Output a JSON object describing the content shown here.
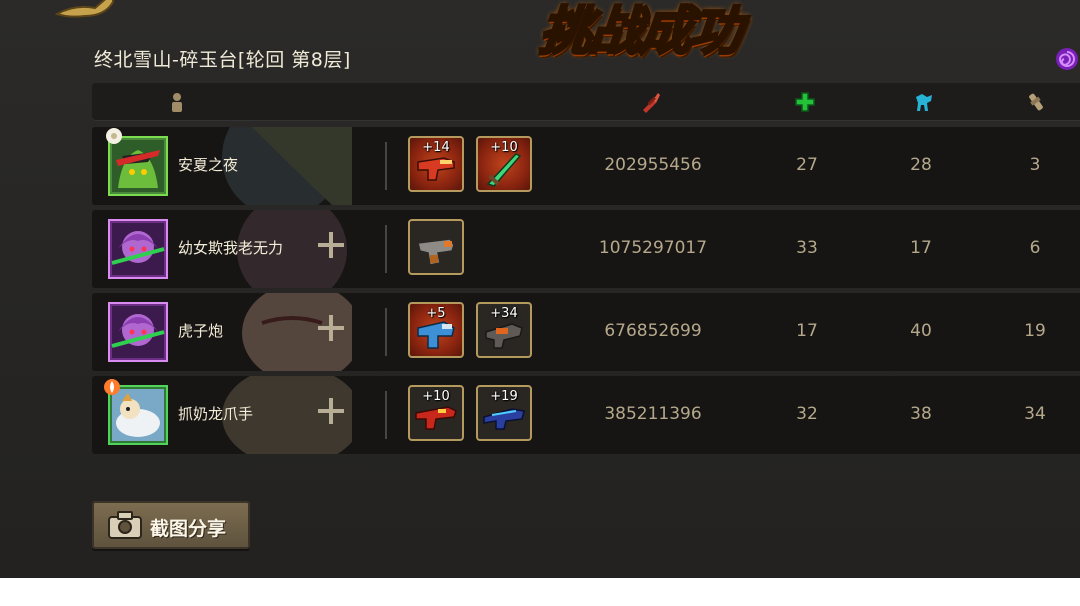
{
  "banner": {
    "title": "挑战成功"
  },
  "stage": {
    "name": "终北雪山-碎玉台[轮回  第8层]"
  },
  "header": {
    "icons": [
      "player-icon",
      "damage-icon",
      "heal-icon",
      "damage-taken-icon",
      "rescue-icon"
    ]
  },
  "colors": {
    "title": "#ffb21e",
    "text": "#f3ecd6",
    "stat": "#b5a88b",
    "item_border": "#b59a5e",
    "heal": "#24c23a",
    "damage": "#c0362a",
    "taken": "#27b3d6"
  },
  "players": [
    {
      "name": "安夏之夜",
      "frame_color": "#3fae3f",
      "has_add": false,
      "items": [
        {
          "level": "+14",
          "icon": "red-blaster-icon",
          "rare": true
        },
        {
          "level": "+10",
          "icon": "green-sword-icon",
          "rare": true
        }
      ],
      "damage": "202955456",
      "heal": "27",
      "taken": "28",
      "save": "3"
    },
    {
      "name": "幼女欺我老无力",
      "frame_color": "#b35bc8",
      "has_add": true,
      "items": [
        {
          "level": "",
          "icon": "pistol-icon",
          "rare": false
        }
      ],
      "damage": "1075297017",
      "heal": "33",
      "taken": "17",
      "save": "6"
    },
    {
      "name": "虎子炮",
      "frame_color": "#b35bc8",
      "has_add": true,
      "items": [
        {
          "level": "+5",
          "icon": "blue-blaster-icon",
          "rare": true
        },
        {
          "level": "+34",
          "icon": "orange-gun-icon",
          "rare": false
        }
      ],
      "damage": "676852699",
      "heal": "17",
      "taken": "40",
      "save": "19"
    },
    {
      "name": "抓奶龙爪手",
      "frame_color": "#3fae3f",
      "has_add": true,
      "items": [
        {
          "level": "+10",
          "icon": "red-rifle-icon",
          "rare": false
        },
        {
          "level": "+19",
          "icon": "blue-rifle-icon",
          "rare": false
        }
      ],
      "damage": "385211396",
      "heal": "32",
      "taken": "38",
      "save": "34"
    }
  ],
  "share_button": {
    "label": "截图分享",
    "icon": "camera-icon"
  }
}
